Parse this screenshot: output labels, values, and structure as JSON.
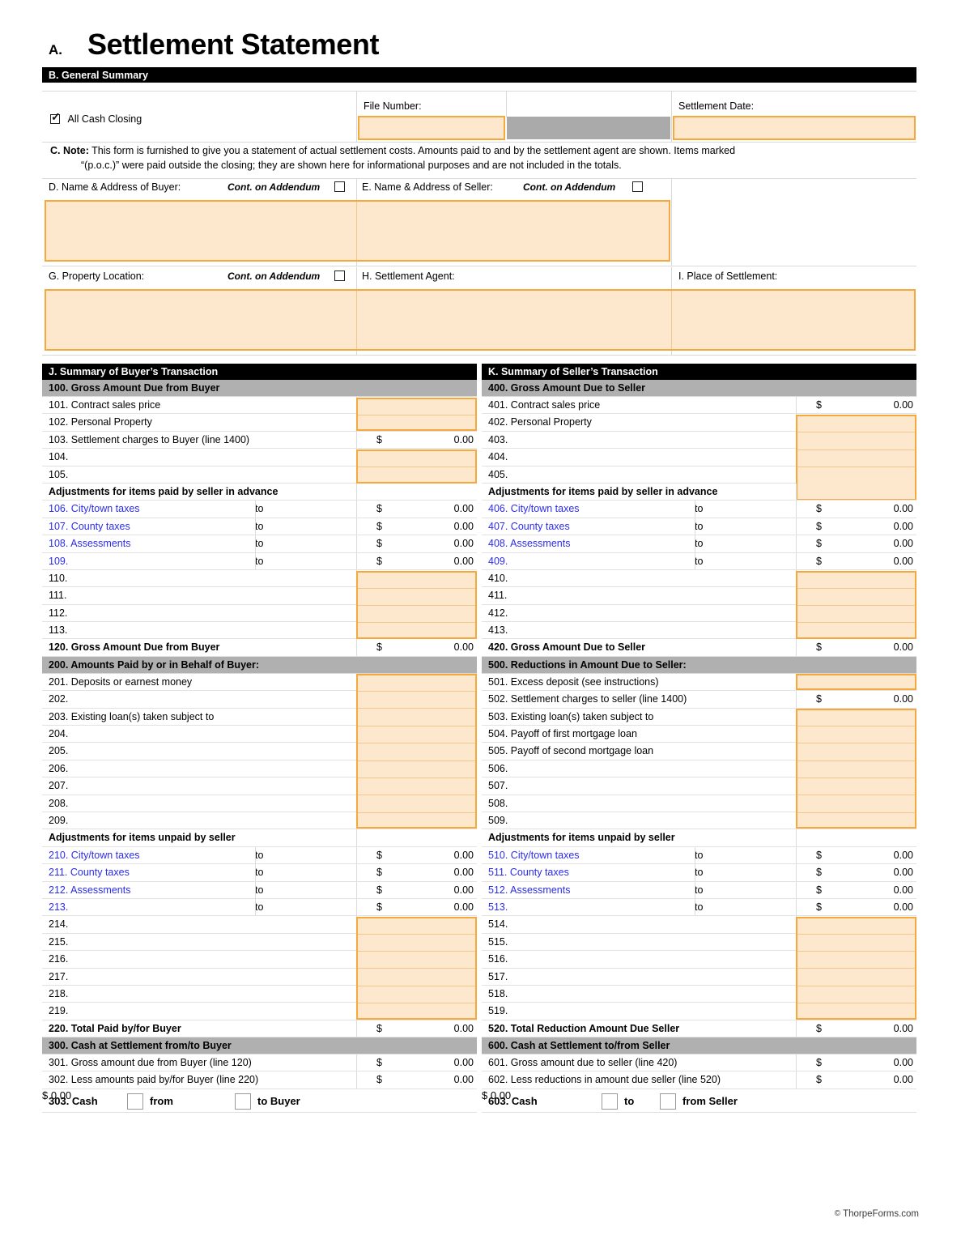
{
  "header": {
    "section_letter": "A.",
    "title": "Settlement Statement",
    "general_summary_bar": "B. General Summary",
    "all_cash_closing": "All Cash Closing",
    "file_number_label": "File Number:",
    "file_number_value": "",
    "settlement_date_label": "Settlement Date:",
    "settlement_date_value": "",
    "note_label": "C. Note:",
    "note_line1": "This form is furnished to give you a statement of actual settlement costs. Amounts paid to and by the settlement agent are shown. Items marked",
    "note_line2": "“(p.o.c.)” were paid outside the closing; they are shown here for informational purposes and are not included in the totals.",
    "buyer_label": "D. Name & Address of Buyer:",
    "seller_label": "E. Name & Address of Seller:",
    "cont_addendum": "Cont. on Addendum",
    "property_label": "G. Property Location:",
    "agent_label": "H. Settlement Agent:",
    "place_label": "I. Place of Settlement:",
    "buyer_value": "",
    "seller_value": "",
    "property_value": "",
    "agent_value": "",
    "place_value": ""
  },
  "colors": {
    "fill": "#FDE7CD",
    "fill_border": "#F5A83C",
    "bar_black": "#000000",
    "bar_gray": "#B0B0B0",
    "blue_text": "#2B2BEE",
    "gray_block": "#AAAAAA"
  },
  "buyer": {
    "section_bar": "J. Summary of Buyer’s Transaction",
    "group100": "100. Gross Amount Due from Buyer",
    "adj_advance": "Adjustments for items paid by seller in advance",
    "adj_unpaid": "Adjustments for items unpaid by seller",
    "group200": "200. Amounts Paid by or in Behalf of Buyer:",
    "group300": "300. Cash at Settlement from/to Buyer",
    "rows100": [
      {
        "label": "101. Contract sales price",
        "amount": "",
        "to": false,
        "blue": false,
        "filled": true
      },
      {
        "label": "102. Personal Property",
        "amount": "",
        "to": false,
        "blue": false,
        "filled": true
      },
      {
        "label": "103. Settlement charges to Buyer (line 1400)",
        "amount": "0.00",
        "to": false,
        "blue": false,
        "filled": false
      },
      {
        "label": "104.",
        "amount": "",
        "to": false,
        "blue": false,
        "filled": true
      },
      {
        "label": "105.",
        "amount": "",
        "to": false,
        "blue": false,
        "filled": true
      }
    ],
    "rows106": [
      {
        "label": "106. City/town taxes",
        "amount": "0.00",
        "to": true,
        "blue": true,
        "filled": false
      },
      {
        "label": "107. County taxes",
        "amount": "0.00",
        "to": true,
        "blue": true,
        "filled": false
      },
      {
        "label": "108. Assessments",
        "amount": "0.00",
        "to": true,
        "blue": true,
        "filled": false
      },
      {
        "label": "109.",
        "amount": "0.00",
        "to": true,
        "blue": true,
        "filled": false
      },
      {
        "label": "110.",
        "amount": "",
        "to": false,
        "blue": false,
        "filled": true
      },
      {
        "label": "111.",
        "amount": "",
        "to": false,
        "blue": false,
        "filled": true
      },
      {
        "label": "112.",
        "amount": "",
        "to": false,
        "blue": false,
        "filled": true
      },
      {
        "label": "113.",
        "amount": "",
        "to": false,
        "blue": false,
        "filled": true
      }
    ],
    "total120": {
      "label": "120. Gross Amount Due from Buyer",
      "amount": "0.00"
    },
    "rows200": [
      {
        "label": "201. Deposits or earnest money",
        "amount": "",
        "to": false,
        "blue": false,
        "filled": true
      },
      {
        "label": "202.",
        "amount": "",
        "to": false,
        "blue": false,
        "filled": true
      },
      {
        "label": "203. Existing loan(s) taken subject to",
        "amount": "",
        "to": false,
        "blue": false,
        "filled": true
      },
      {
        "label": "204.",
        "amount": "",
        "to": false,
        "blue": false,
        "filled": true
      },
      {
        "label": "205.",
        "amount": "",
        "to": false,
        "blue": false,
        "filled": true
      },
      {
        "label": "206.",
        "amount": "",
        "to": false,
        "blue": false,
        "filled": true
      },
      {
        "label": "207.",
        "amount": "",
        "to": false,
        "blue": false,
        "filled": true
      },
      {
        "label": "208.",
        "amount": "",
        "to": false,
        "blue": false,
        "filled": true
      },
      {
        "label": "209.",
        "amount": "",
        "to": false,
        "blue": false,
        "filled": true
      }
    ],
    "rows210": [
      {
        "label": "210. City/town taxes",
        "amount": "0.00",
        "to": true,
        "blue": true,
        "filled": false
      },
      {
        "label": "211. County taxes",
        "amount": "0.00",
        "to": true,
        "blue": true,
        "filled": false
      },
      {
        "label": "212. Assessments",
        "amount": "0.00",
        "to": true,
        "blue": true,
        "filled": false
      },
      {
        "label": "213.",
        "amount": "0.00",
        "to": true,
        "blue": true,
        "filled": false
      },
      {
        "label": "214.",
        "amount": "",
        "to": false,
        "blue": false,
        "filled": true
      },
      {
        "label": "215.",
        "amount": "",
        "to": false,
        "blue": false,
        "filled": true
      },
      {
        "label": "216.",
        "amount": "",
        "to": false,
        "blue": false,
        "filled": true
      },
      {
        "label": "217.",
        "amount": "",
        "to": false,
        "blue": false,
        "filled": true
      },
      {
        "label": "218.",
        "amount": "",
        "to": false,
        "blue": false,
        "filled": true
      },
      {
        "label": "219.",
        "amount": "",
        "to": false,
        "blue": false,
        "filled": true
      }
    ],
    "total220": {
      "label": "220. Total Paid by/for Buyer",
      "amount": "0.00"
    },
    "rows300": [
      {
        "label": "301. Gross amount due from Buyer (line 120)",
        "amount": "0.00"
      },
      {
        "label": "302. Less amounts paid by/for Buyer (line 220)",
        "amount": "0.00"
      }
    ],
    "cash_row": {
      "label": "303. Cash",
      "word1": "from",
      "word2": "to Buyer",
      "amount": "0.00"
    }
  },
  "seller": {
    "section_bar": "K. Summary of Seller’s Transaction",
    "group400": "400. Gross Amount Due to Seller",
    "adj_advance": "Adjustments for items paid by seller in advance",
    "adj_unpaid": "Adjustments for items unpaid by seller",
    "group500": "500. Reductions in Amount Due to Seller:",
    "group600": "600. Cash at Settlement to/from Seller",
    "rows400": [
      {
        "label": "401. Contract sales price",
        "amount": "0.00",
        "to": false,
        "blue": false,
        "filled": false
      },
      {
        "label": "402. Personal Property",
        "amount": "",
        "to": false,
        "blue": false,
        "filled": true
      },
      {
        "label": "403.",
        "amount": "",
        "to": false,
        "blue": false,
        "filled": true
      },
      {
        "label": "404.",
        "amount": "",
        "to": false,
        "blue": false,
        "filled": true
      },
      {
        "label": "405.",
        "amount": "",
        "to": false,
        "blue": false,
        "filled": true
      }
    ],
    "rows406": [
      {
        "label": "406. City/town taxes",
        "amount": "0.00",
        "to": true,
        "blue": true,
        "filled": false
      },
      {
        "label": "407. County taxes",
        "amount": "0.00",
        "to": true,
        "blue": true,
        "filled": false
      },
      {
        "label": "408. Assessments",
        "amount": "0.00",
        "to": true,
        "blue": true,
        "filled": false
      },
      {
        "label": "409.",
        "amount": "0.00",
        "to": true,
        "blue": true,
        "filled": false
      },
      {
        "label": "410.",
        "amount": "",
        "to": false,
        "blue": false,
        "filled": true
      },
      {
        "label": "411.",
        "amount": "",
        "to": false,
        "blue": false,
        "filled": true
      },
      {
        "label": "412.",
        "amount": "",
        "to": false,
        "blue": false,
        "filled": true
      },
      {
        "label": "413.",
        "amount": "",
        "to": false,
        "blue": false,
        "filled": true
      }
    ],
    "total420": {
      "label": "420. Gross Amount Due to Seller",
      "amount": "0.00"
    },
    "rows500": [
      {
        "label": "501. Excess deposit (see instructions)",
        "amount": "",
        "to": false,
        "blue": false,
        "filled": true
      },
      {
        "label": "502. Settlement charges to seller (line 1400)",
        "amount": "0.00",
        "to": false,
        "blue": false,
        "filled": false
      },
      {
        "label": "503. Existing loan(s) taken subject to",
        "amount": "",
        "to": false,
        "blue": false,
        "filled": true
      },
      {
        "label": "504. Payoff of first mortgage loan",
        "amount": "",
        "to": false,
        "blue": false,
        "filled": true
      },
      {
        "label": "505. Payoff of second mortgage loan",
        "amount": "",
        "to": false,
        "blue": false,
        "filled": true
      },
      {
        "label": "506.",
        "amount": "",
        "to": false,
        "blue": false,
        "filled": true
      },
      {
        "label": "507.",
        "amount": "",
        "to": false,
        "blue": false,
        "filled": true
      },
      {
        "label": "508.",
        "amount": "",
        "to": false,
        "blue": false,
        "filled": true
      },
      {
        "label": "509.",
        "amount": "",
        "to": false,
        "blue": false,
        "filled": true
      }
    ],
    "rows510": [
      {
        "label": "510. City/town taxes",
        "amount": "0.00",
        "to": true,
        "blue": true,
        "filled": false
      },
      {
        "label": "511. County taxes",
        "amount": "0.00",
        "to": true,
        "blue": true,
        "filled": false
      },
      {
        "label": "512. Assessments",
        "amount": "0.00",
        "to": true,
        "blue": true,
        "filled": false
      },
      {
        "label": "513.",
        "amount": "0.00",
        "to": true,
        "blue": true,
        "filled": false
      },
      {
        "label": "514.",
        "amount": "",
        "to": false,
        "blue": false,
        "filled": true
      },
      {
        "label": "515.",
        "amount": "",
        "to": false,
        "blue": false,
        "filled": true
      },
      {
        "label": "516.",
        "amount": "",
        "to": false,
        "blue": false,
        "filled": true
      },
      {
        "label": "517.",
        "amount": "",
        "to": false,
        "blue": false,
        "filled": true
      },
      {
        "label": "518.",
        "amount": "",
        "to": false,
        "blue": false,
        "filled": true
      },
      {
        "label": "519.",
        "amount": "",
        "to": false,
        "blue": false,
        "filled": true
      }
    ],
    "total520": {
      "label": "520. Total Reduction Amount Due Seller",
      "amount": "0.00"
    },
    "rows600": [
      {
        "label": "601. Gross amount due to seller (line 420)",
        "amount": "0.00"
      },
      {
        "label": "602. Less reductions in amount due seller (line 520)",
        "amount": "0.00"
      }
    ],
    "cash_row": {
      "label": "603. Cash",
      "word1": "to",
      "word2": "from Seller",
      "amount": "0.00"
    }
  },
  "footer": {
    "copyright_symbol": "©",
    "text": "ThorpeForms.com"
  },
  "dollar_sign": "$"
}
